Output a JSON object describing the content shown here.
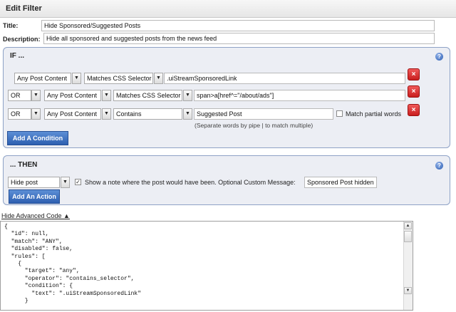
{
  "header": {
    "title": "Edit Filter"
  },
  "form": {
    "title_label": "Title:",
    "title_value": "Hide Sponsored/Suggested Posts",
    "description_label": "Description:",
    "description_value": "Hide all sponsored and suggested posts from the news feed"
  },
  "if_panel": {
    "title": "IF ...",
    "help": "?",
    "rows": [
      {
        "combinator": "",
        "target": "Any Post Content",
        "operator": "Matches CSS Selector",
        "value": ".uiStreamSponsoredLink"
      },
      {
        "combinator": "OR",
        "target": "Any Post Content",
        "operator": "Matches CSS Selector",
        "value": "span>a[href^=\"/about/ads\"]"
      },
      {
        "combinator": "OR",
        "target": "Any Post Content",
        "operator": "Contains",
        "value": "Suggested Post",
        "partial_label": "Match partial words",
        "hint": "(Separate words by pipe | to match multiple)"
      }
    ],
    "remove_label": "×",
    "add_condition": "Add A Condition"
  },
  "then_panel": {
    "title": "... THEN",
    "help": "?",
    "action": "Hide post",
    "show_note_label": "Show a note where the post would have been. Optional Custom Message:",
    "custom_message": "Sponsored Post hidden",
    "add_action": "Add An Action"
  },
  "advanced": {
    "toggle": "Hide Advanced Code ▲",
    "code": "{\n  \"id\": null,\n  \"match\": \"ANY\",\n  \"disabled\": false,\n  \"rules\": [\n    {\n      \"target\": \"any\",\n      \"operator\": \"contains_selector\",\n      \"condition\": {\n        \"text\": \".uiStreamSponsoredLink\"\n      }"
  },
  "icons": {
    "dropdown": "▼",
    "scroll_up": "▲",
    "scroll_down": "▼"
  },
  "colors": {
    "accent": "#2d5fb0",
    "danger": "#c81e1e",
    "panel_border": "#8ea2c6",
    "panel_bg": "#eceef4"
  }
}
